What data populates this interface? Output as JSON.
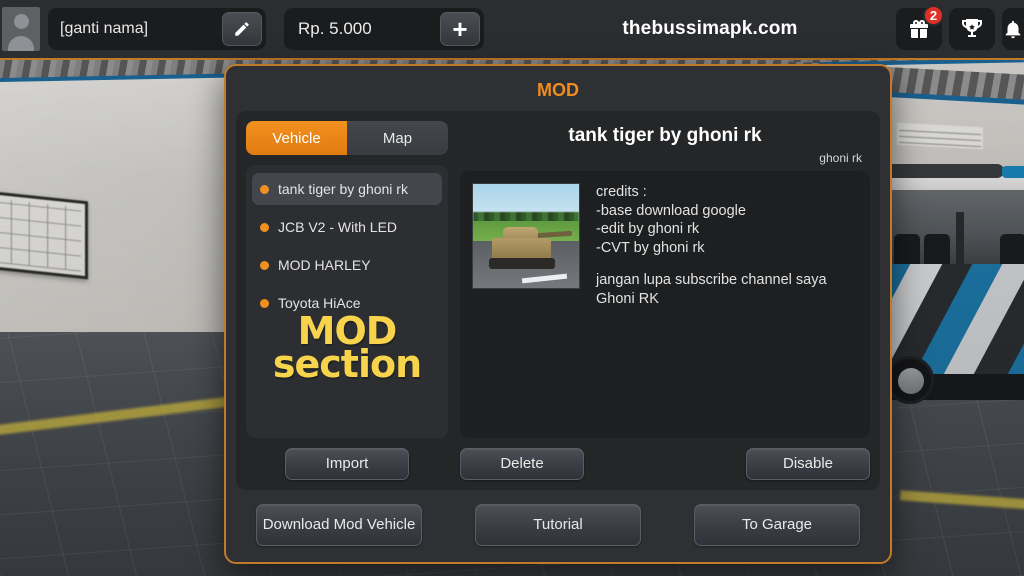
{
  "topbar": {
    "avatar_name": "avatar",
    "player_name": "[ganti nama]",
    "edit_icon": "pencil-icon",
    "money": "Rp. 5.000",
    "plus_label": "+",
    "site_title": "thebussimapk.com",
    "icons": [
      {
        "name": "gift-icon",
        "badge": "2"
      },
      {
        "name": "trophy-icon",
        "badge": ""
      },
      {
        "name": "bell-icon",
        "badge": ""
      }
    ]
  },
  "dialog": {
    "title": "MOD",
    "tabs": [
      {
        "label": "Vehicle",
        "active": true
      },
      {
        "label": "Map",
        "active": false
      }
    ],
    "mod_list": [
      {
        "label": "tank tiger by ghoni rk",
        "selected": true
      },
      {
        "label": "JCB V2 - With LED",
        "selected": false
      },
      {
        "label": "MOD HARLEY",
        "selected": false
      },
      {
        "label": "Toyota HiAce",
        "selected": false
      }
    ],
    "watermark": {
      "line1": "MOD",
      "line2": "section"
    },
    "import_label": "Import",
    "detail": {
      "title": "tank tiger by ghoni rk",
      "author": "ghoni rk",
      "thumbnail": "tank-thumbnail",
      "description_lines": [
        "credits :",
        "-base download google",
        "-edit by ghoni rk",
        "-CVT by ghoni rk",
        "",
        "jangan lupa subscribe channel saya",
        "Ghoni RK"
      ],
      "delete_label": "Delete",
      "disable_label": "Disable"
    },
    "footer": {
      "download_label": "Download Mod Vehicle",
      "tutorial_label": "Tutorial",
      "garage_label": "To Garage"
    }
  },
  "colors": {
    "accent_orange": "#f08c1e",
    "dialog_border": "#c17a28",
    "badge_red": "#e03127",
    "watermark_yellow": "#f7d44c",
    "panel_bg": "#2e3034",
    "inner_bg": "#242628"
  }
}
